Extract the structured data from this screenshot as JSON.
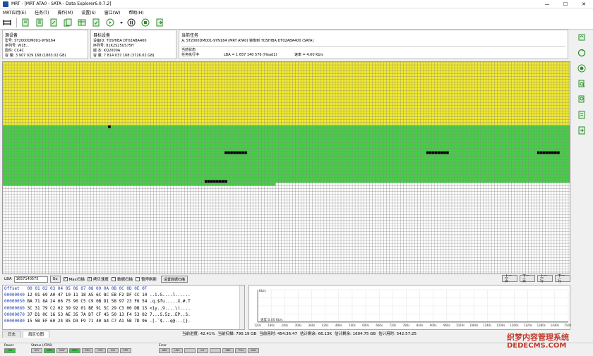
{
  "window": {
    "title": "MRT - [MRT ATA0 - SATA - Data Explorer6.0.7.2]",
    "min": "—",
    "max": "☐",
    "close": "✕"
  },
  "menu": [
    "MRT应用(E)",
    "任务(T)",
    "操作(M)",
    "设置(S)",
    "窗口(W)",
    "帮助(H)"
  ],
  "source": {
    "title": "源设备",
    "model": "型号: ST2000DM001-9YN164",
    "serial": "序列号: W1E...",
    "fw": "固件: CC4C",
    "capacity": "容 量: 3 907 029 168 (1863.02 GB)"
  },
  "target": {
    "title": "目标设备",
    "model": "设备ID: TOSHIBA DT02ABA400",
    "serial": "序列号: 81K2S25US75H",
    "fw": "版 本: KQ2000A",
    "capacity": "容 量: 7 814 037 168 (3726.02 GB)"
  },
  "task": {
    "title": "当前任务",
    "desc": "从 ST2000DM001-9YN164 (MRT ATA0) 镜像到 TOSHIBA DT02ABA400 (SATA)",
    "state_title": "当前状态",
    "state": "任务执行中",
    "lba": "LBA = 1 657 140 576 (Head1)",
    "speed": "速率 = 4.00 Kb/s"
  },
  "controls": {
    "lba_label": "LBA",
    "lba_value": "1657140575",
    "go": "Go",
    "max_label": "Max扫描",
    "copy_label": "拷贝速度",
    "data_scan_label": "数据扫描",
    "pause_label": "暂停刷新",
    "set_scan": "设置数据扫描",
    "prev_page": "上一页",
    "next_page": "下一页",
    "prev_line": "上一行",
    "next_line": "下一行"
  },
  "hex": {
    "header": "Offset   00 01 02 03 04 05 06 07 08 09 0A 0B 0C 0D 0E 0F",
    "rows": [
      {
        "offset": "00000040",
        "bytes": "12 01 69 A0 47 10 11 18 A5 6C 8C EB F2 DF CC 10",
        "ascii": "..i.G....l......"
      },
      {
        "offset": "00000050",
        "bytes": "BA 71 8A 24 66 75 90 C5 C9 0B D1 58 97 23 F6 54",
        "ascii": ".q.$fu.....X.#.T"
      },
      {
        "offset": "00000060",
        "bytes": "3C 31 79 C2 02 39 92 01 BE 91 5C 29 C3 00 DB 15",
        "ascii": "<1y..9....\\)...."
      },
      {
        "offset": "00000070",
        "bytes": "37 D1 0C 16 53 AE 35 7A D7 CF 45 50 13 F4 53 02",
        "ascii": "7...S.5z..EP..S."
      },
      {
        "offset": "00000080",
        "bytes": "15 5B EF 60 24 85 D3 F9 71 40 A4 C7 A1 5B 7D 96",
        "ascii": ".[.`$...q@...[}."
      }
    ]
  },
  "chart_data": {
    "type": "line",
    "title": "",
    "ylabel": "Kb/s",
    "xlabel": "",
    "x": [
      "120s",
      "180s",
      "240s",
      "300s",
      "360s",
      "420s",
      "480s",
      "540s",
      "600s",
      "660s",
      "720s",
      "780s",
      "840s",
      "900s",
      "960s",
      "1020s",
      "1080s",
      "1140s",
      "1200s",
      "1260s",
      "1320s",
      "1380s",
      "1440s",
      "1500s"
    ],
    "series": [
      {
        "values": [
          4,
          4,
          4,
          4,
          4,
          4,
          4,
          4,
          4,
          4,
          4,
          4,
          4,
          4,
          4,
          4,
          4,
          4,
          4,
          4,
          4,
          4,
          4,
          4
        ]
      }
    ],
    "annotation": "速度:0.00 Kb/s",
    "grid": true
  },
  "tabs": [
    "日志",
    "扇区位图"
  ],
  "stats": {
    "progress": "当前进度: 42.41%",
    "scanned": "当前扫描: 790.19 GB",
    "time_used": "当前用时: 454:36:47",
    "remain": "估计剩余: 66.13K",
    "remain_size": "估计剩余: 1604.75 GB",
    "total_time": "估计用时: 542:57:25"
  },
  "status": {
    "power_label": "Power",
    "power_leds": [
      "ON"
    ],
    "status_label": "Status (ATA0)",
    "status_leds": [
      "BSY",
      "DRD",
      "DWF",
      "DSC",
      "DRQ",
      "CRR",
      "IDX",
      "ERR"
    ],
    "status_on": [
      false,
      true,
      false,
      true,
      false,
      false,
      false,
      false
    ],
    "error_label": "Error",
    "error_leds": [
      "BBK",
      "UNC",
      "",
      "INF",
      "",
      "ABR",
      "TON",
      "AMN"
    ]
  },
  "watermark": {
    "line1": "织梦内容管理系统",
    "line2": "DEDECMS.COM"
  },
  "sector_map": {
    "rows": 74,
    "cols": 200,
    "yellow_rows": 22,
    "green_rows": 20,
    "partial_green_cols": 96,
    "colors": {
      "yellow": "#f2ea2a",
      "green": "#44cf44",
      "white": "#ffffff",
      "bad": "#000000",
      "line": "#8a8a8a"
    }
  }
}
